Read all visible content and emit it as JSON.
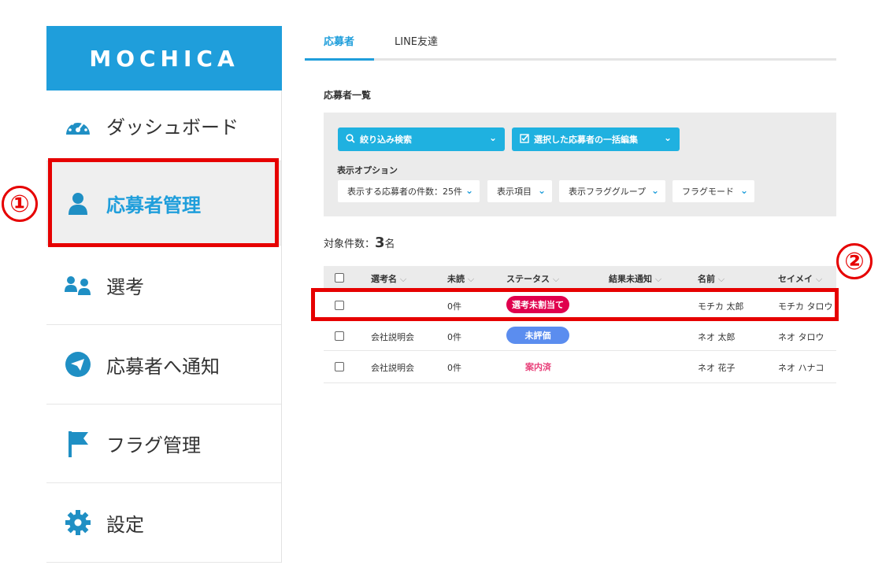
{
  "app": {
    "logo_text": "MOCHICA"
  },
  "sidebar": {
    "items": [
      {
        "label": "ダッシュボード",
        "icon": "dashboard-gauge-icon"
      },
      {
        "label": "応募者管理",
        "icon": "person-icon",
        "active": true
      },
      {
        "label": "選考",
        "icon": "group-icon"
      },
      {
        "label": "応募者へ通知",
        "icon": "paper-plane-icon"
      },
      {
        "label": "フラグ管理",
        "icon": "flag-icon"
      },
      {
        "label": "設定",
        "icon": "gear-icon"
      }
    ]
  },
  "annotations": {
    "marker1": "①",
    "marker2": "②"
  },
  "tabs": [
    {
      "label": "応募者",
      "active": true
    },
    {
      "label": "LINE友達",
      "active": false
    }
  ],
  "main": {
    "section_title": "応募者一覧",
    "filter": {
      "search_button": "絞り込み検索",
      "bulk_edit_button": "選択した応募者の一括編集",
      "options_label": "表示オプション",
      "options": [
        "表示する応募者の件数：25件",
        "表示項目",
        "表示フラググループ",
        "フラグモード"
      ]
    },
    "count": {
      "prefix": "対象件数：",
      "value": "3",
      "suffix": "名"
    },
    "table": {
      "headers": [
        "選考名",
        "未読",
        "ステータス",
        "結果未通知",
        "名前",
        "セイメイ"
      ],
      "rows": [
        {
          "selection": "",
          "unread": "0件",
          "status": "選考未割当て",
          "status_style": "red-pill",
          "result": "",
          "name": "モチカ 太郎",
          "kana": "モチカ タロウ"
        },
        {
          "selection": "会社説明会",
          "unread": "0件",
          "status": "未評価",
          "status_style": "blue-pill",
          "result": "",
          "name": "ネオ 太郎",
          "kana": "ネオ タロウ"
        },
        {
          "selection": "会社説明会",
          "unread": "0件",
          "status": "案内済",
          "status_style": "pink-text",
          "result": "",
          "name": "ネオ 花子",
          "kana": "ネオ ハナコ"
        }
      ]
    }
  },
  "colors": {
    "brand": "#1f9edb",
    "button": "#1fb1e0",
    "highlight": "#e60000",
    "badge_red": "#e0004d",
    "badge_blue": "#5b8def",
    "text_pink": "#e8417a"
  }
}
